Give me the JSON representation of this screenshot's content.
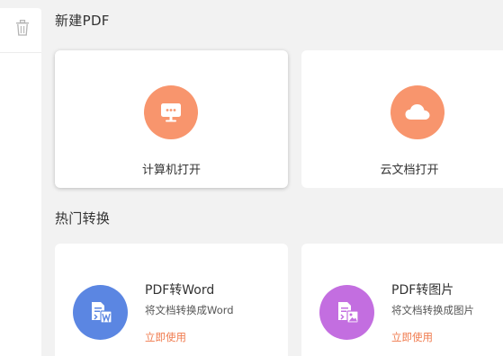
{
  "sidebar": {
    "icon": "trash-icon"
  },
  "sections": {
    "new_pdf": "新建PDF",
    "hot": "热门转换"
  },
  "open_cards": [
    {
      "label": "计算机打开",
      "icon": "monitor-icon"
    },
    {
      "label": "云文档打开",
      "icon": "cloud-icon"
    }
  ],
  "convert_cards": [
    {
      "title": "PDF转Word",
      "desc": "将文档转换成Word",
      "link": "立即使用",
      "icon": "pdf-to-word-icon"
    },
    {
      "title": "PDF转图片",
      "desc": "将文档转换成图片",
      "link": "立即使用",
      "icon": "pdf-to-image-icon"
    }
  ],
  "colors": {
    "accent_orange": "#f8956d",
    "word_blue": "#5b86e2",
    "image_purple": "#c36ee0",
    "link": "#f07b4e"
  }
}
